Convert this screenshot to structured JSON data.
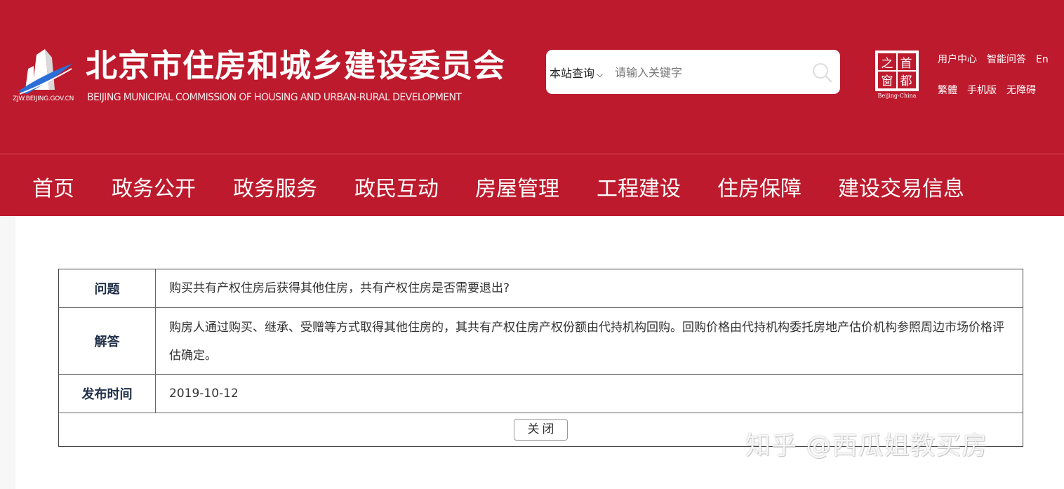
{
  "header": {
    "domain": "ZJW.BEIJING.GOV.CN",
    "title": "北京市住房和城乡建设委员会",
    "subtitle": "BEIJING MUNICIPAL COMMISSION OF HOUSING AND URBAN-RURAL DEVELOPMENT",
    "search": {
      "scope_label": "本站查询",
      "placeholder": "请输入关键字"
    },
    "emblem": {
      "chars": [
        "之",
        "首",
        "窗",
        "都"
      ],
      "caption": "Beijing-China"
    },
    "links_row1": [
      "用户中心",
      "智能问答",
      "En"
    ],
    "links_row2": [
      "繁體",
      "手机版",
      "无障碍"
    ]
  },
  "nav": {
    "items": [
      "首页",
      "政务公开",
      "政务服务",
      "政民互动",
      "房屋管理",
      "工程建设",
      "住房保障",
      "建设交易信息"
    ]
  },
  "qa": {
    "question_label": "问题",
    "question": "购买共有产权住房后获得其他住房，共有产权住房是否需要退出?",
    "answer_label": "解答",
    "answer": "购房人通过购买、继承、受赠等方式取得其他住房的，其共有产权住房产权份额由代持机构回购。回购价格由代持机构委托房地产估价机构参照周边市场价格评估确定。",
    "date_label": "发布时间",
    "date": "2019-10-12",
    "close_label": "关闭"
  },
  "watermark": "知乎 @西瓜姐教买房",
  "colors": {
    "brand_red": "#bd1a2d",
    "label_navy": "#22304a"
  }
}
